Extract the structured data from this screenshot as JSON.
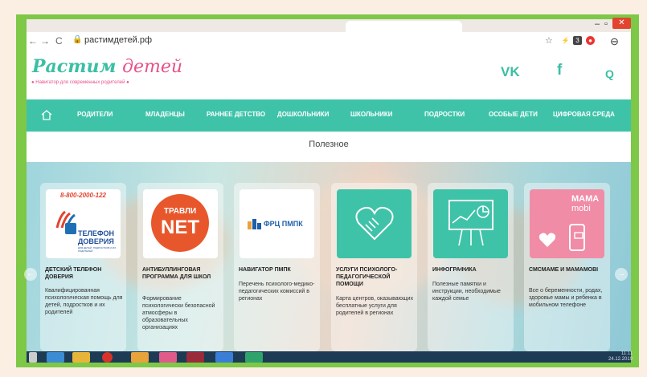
{
  "browser": {
    "url": "растимдетей.рф",
    "nav_back": "←",
    "nav_forward": "→",
    "reload": "C",
    "ext_badge": "3"
  },
  "site": {
    "logo_word1": "Растим",
    "logo_word2": "детей",
    "tagline": "Навигатор для современных родителей",
    "social_vk": "VK",
    "social_fb": "f",
    "search_glyph": "Q"
  },
  "nav": {
    "items": [
      "РОДИТЕЛИ",
      "МЛАДЕНЦЫ",
      "РАННЕЕ ДЕТСТВО",
      "ДОШКОЛЬНИКИ",
      "ШКОЛЬНИКИ",
      "ПОДРОСТКИ",
      "ОСОБЫЕ ДЕТИ",
      "ЦИФРОВАЯ СРЕДА"
    ]
  },
  "section": {
    "title": "Полезное"
  },
  "cards": [
    {
      "title": "ДЕТСКИЙ ТЕЛЕФОН ДОВЕРИЯ",
      "desc": "Квалифицированная психологическая помощь для детей, подростков и их родителей",
      "thumb_text_1": "8-800-2000-122",
      "thumb_text_2": "ТЕЛЕФОН",
      "thumb_text_3": "ДОВЕРИЯ",
      "thumb_text_4": "ДЛЯ ДЕТЕЙ, ПОДРОСТКОВ И ИХ РОДИТЕЛЕЙ"
    },
    {
      "title": "АНТИБУЛЛИНГОВАЯ ПРОГРАММА ДЛЯ ШКОЛ",
      "desc": "Формирование психологически безопасной атмосферы в образовательных организациях",
      "thumb_text_1": "ТРАВЛИ",
      "thumb_text_2": "NET"
    },
    {
      "title": "НАВИГАТОР ПМПК",
      "desc": "Перечень психолого-медико-педагогических комиссий в регионах",
      "thumb_text_1": "ФРЦ ПМПК"
    },
    {
      "title": "УСЛУГИ ПСИХОЛОГО-ПЕДАГОГИЧЕСКОЙ ПОМОЩИ",
      "desc": "Карта центров, оказывающих бесплатные услуги для родителей в регионах"
    },
    {
      "title": "ИНФОГРАФИКА",
      "desc": "Полезные памятки и инструкции, необходимые каждой семье"
    },
    {
      "title": "СМСМАМЕ И МАМАМОВІ",
      "desc": "Все о беременности, родах, здоровье мамы и ребенка в мобильном телефоне",
      "thumb_text_1": "MAMA",
      "thumb_text_2": "mobi"
    }
  ],
  "taskbar": {
    "time": "11:11",
    "date": "24.12.2019"
  },
  "colors": {
    "accent": "#3fc3a8",
    "pink": "#e8508a",
    "frame_green": "#7dc847"
  }
}
